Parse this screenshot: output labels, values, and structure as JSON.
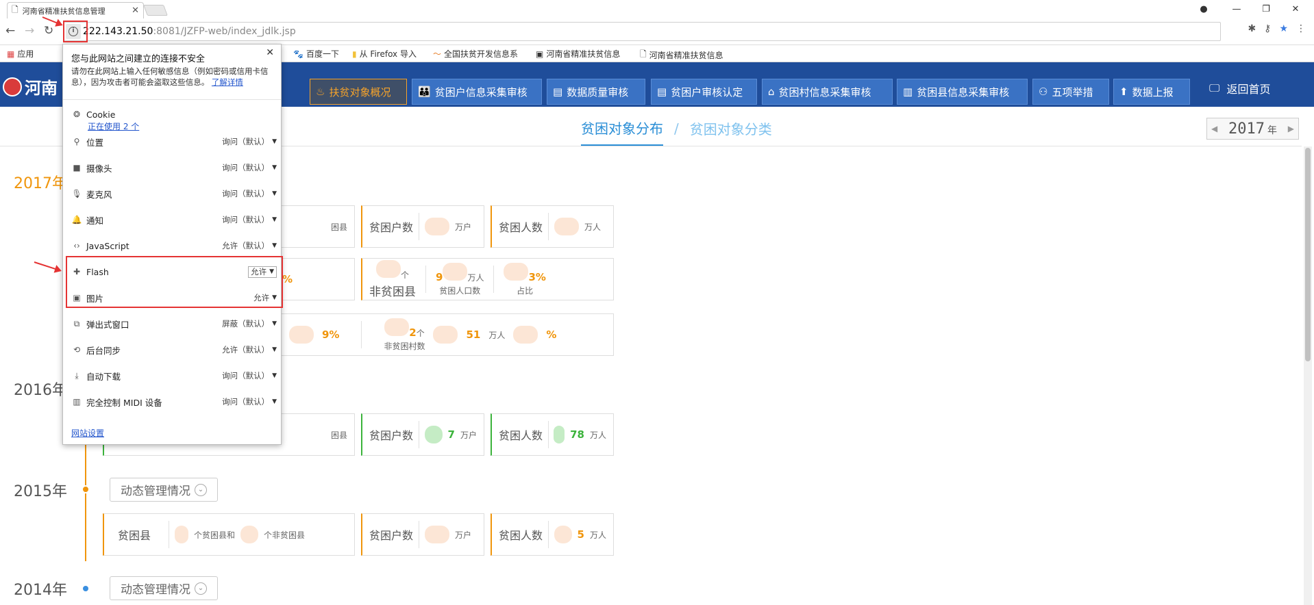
{
  "browser": {
    "tab_title": "河南省精准扶贫信息管理",
    "url_host": "222.143.21.50",
    "url_rest": ":8081/JZFP-web/index_jdlk.jsp"
  },
  "bookmarks": [
    {
      "label": "应用"
    },
    {
      "label": "百度一下"
    },
    {
      "label": "从 Firefox 导入"
    },
    {
      "label": "全国扶贫开发信息系"
    },
    {
      "label": "河南省精准扶贫信息"
    },
    {
      "label": "河南省精准扶贫信息"
    }
  ],
  "header": {
    "logo_text": "河南",
    "nav": [
      {
        "label": "扶贫对象概况"
      },
      {
        "label": "贫困户信息采集审核"
      },
      {
        "label": "数据质量审核"
      },
      {
        "label": "贫困户审核认定"
      },
      {
        "label": "贫困村信息采集审核"
      },
      {
        "label": "贫困县信息采集审核"
      },
      {
        "label": "五项举措"
      },
      {
        "label": "数据上报"
      }
    ],
    "home_label": "返回首页"
  },
  "subtabs": {
    "tab1": "贫困对象分布",
    "sep": "/",
    "tab2": "贫困对象分类"
  },
  "year_picker": {
    "value": "2017",
    "unit": "年"
  },
  "timeline": {
    "y2017": "2017年",
    "y2016": "2016年",
    "y2015": "2015年",
    "y2014": "2014年",
    "dyn_label": "动态管理情况"
  },
  "cards2017": {
    "county_unit": "困县",
    "hh_label": "贫困户数",
    "hh_unit": "万户",
    "pop_label": "贫困人数",
    "pop_unit": "万人",
    "pct1": "02%",
    "c2_unit_ge": "个",
    "c2_label": "非贫困县",
    "c2_num": "9",
    "c2_wanren": "万人",
    "c2_sub_pop": "贫困人口数",
    "c2_pct": "3%",
    "c2_sub_pct": "占比",
    "r3_pct": "9%",
    "r3_num": "2",
    "r3_ge": "个",
    "r3_sub": "非贫困村数",
    "r3_num2": "51",
    "r3_wanren": "万人",
    "r3_pct2": "%"
  },
  "cards2016": {
    "county_unit": "困县",
    "hh_label": "贫困户数",
    "hh_num": "7",
    "hh_unit": "万户",
    "pop_label": "贫困人数",
    "pop_num": "78",
    "pop_unit": "万人"
  },
  "cards2015": {
    "county_label": "贫困县",
    "county_mid": "个贫困县和",
    "county_tail": "个非贫困县",
    "hh_label": "贫困户数",
    "hh_unit": "万户",
    "pop_label": "贫困人数",
    "pop_num": "5",
    "pop_unit": "万人"
  },
  "popup": {
    "warn_title": "您与此网站之间建立的连接不安全",
    "warn_body": "请勿在此网站上输入任何敏感信息（例如密码或信用卡信息），因为攻击者可能会盗取这些信息。",
    "learn_more": "了解详情",
    "cookie_label": "Cookie",
    "cookie_sub": "正在使用 2 个",
    "rows": [
      {
        "name": "位置",
        "value": "询问（默认）"
      },
      {
        "name": "摄像头",
        "value": "询问（默认）"
      },
      {
        "name": "麦克风",
        "value": "询问（默认）"
      },
      {
        "name": "通知",
        "value": "询问（默认）"
      },
      {
        "name": "JavaScript",
        "value": "允许（默认）"
      },
      {
        "name": "Flash",
        "value": "允许"
      },
      {
        "name": "图片",
        "value": "允许"
      },
      {
        "name": "弹出式窗口",
        "value": "屏蔽（默认）"
      },
      {
        "name": "后台同步",
        "value": "允许（默认）"
      },
      {
        "name": "自动下载",
        "value": "询问（默认）"
      },
      {
        "name": "完全控制 MIDI 设备",
        "value": "询问（默认）"
      }
    ],
    "site_settings": "网站设置"
  },
  "colors": {
    "header": "#1f4d9a",
    "accent_orange": "#f0950b",
    "accent_green": "#3bb33b",
    "highlight_red": "#e53333"
  }
}
